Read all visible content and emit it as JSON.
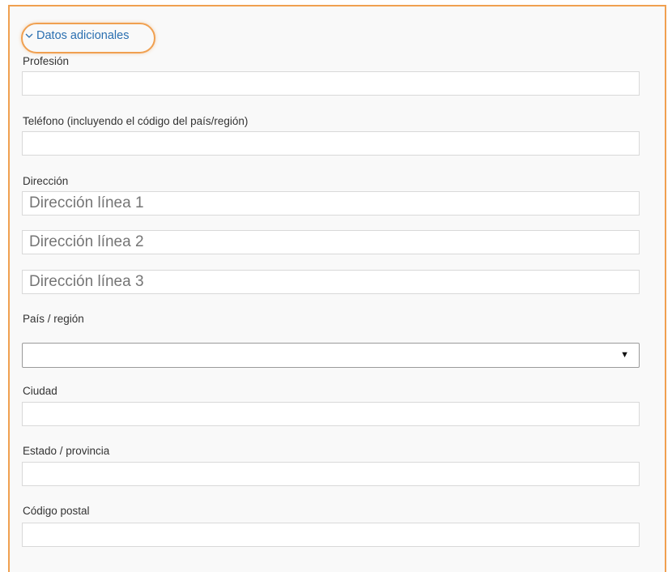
{
  "section": {
    "title": "Datos adicionales",
    "icon": "chevron-down-icon",
    "accent_color": "#f0a050",
    "link_color": "#2a6fb0"
  },
  "fields": {
    "profession_label": "Profesión",
    "profession_value": "",
    "phone_label": "Teléfono (incluyendo el código del país/región)",
    "phone_value": "",
    "address_label": "Dirección",
    "address_line1_placeholder": "Dirección línea 1",
    "address_line2_placeholder": "Dirección línea 2",
    "address_line3_placeholder": "Dirección línea 3",
    "country_label": "País / región",
    "country_selected": "",
    "city_label": "Ciudad",
    "city_value": "",
    "state_label": "Estado / provincia",
    "state_value": "",
    "postal_label": "Código postal",
    "postal_value": ""
  }
}
